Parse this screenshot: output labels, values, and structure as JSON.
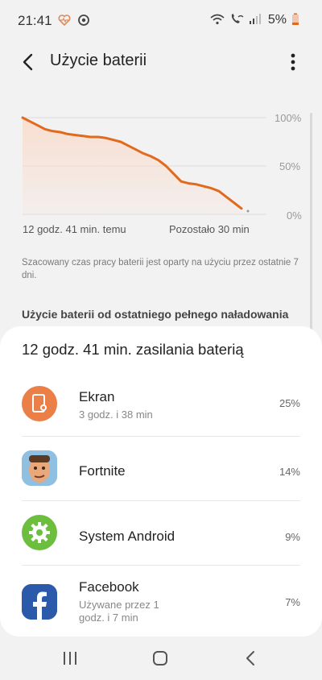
{
  "status_bar": {
    "time": "21:41",
    "battery_percent": "5%",
    "icons": [
      "heart-rate-icon",
      "sync-icon",
      "wifi-icon",
      "wifi-calling-icon",
      "signal-icon",
      "battery-low-icon"
    ]
  },
  "header": {
    "title": "Użycie baterii"
  },
  "chart_data": {
    "type": "area",
    "x_labels": {
      "start": "12 godz. 41 min. temu",
      "end": "Pozostało 30 min"
    },
    "y_ticks": [
      "100%",
      "50%",
      "0%"
    ],
    "ylim": [
      0,
      100
    ],
    "series": [
      {
        "values": [
          100,
          96,
          92,
          88,
          86,
          85,
          83,
          82,
          81,
          80,
          80,
          79,
          77,
          75,
          71,
          67,
          63,
          60,
          56,
          50,
          42,
          34,
          32,
          31,
          29,
          27,
          24,
          18,
          12,
          6
        ]
      }
    ],
    "line_color": "#e06a1e",
    "fill_color": "#f9dccd",
    "grid": true
  },
  "note": "Szacowany czas pracy baterii jest oparty na użyciu przez ostatnie 7 dni.",
  "section_header": "Użycie baterii od ostatniego pełnego naładowania",
  "usage_card": {
    "title": "12 godz. 41 min. zasilania baterią",
    "apps": [
      {
        "name": "Ekran",
        "sub": "3 godz. i 38 min",
        "percent": "25%",
        "icon": "screen-brightness-icon"
      },
      {
        "name": "Fortnite",
        "sub": "",
        "percent": "14%",
        "icon": "fortnite-app-icon"
      },
      {
        "name": "System Android",
        "sub": "",
        "percent": "9%",
        "icon": "android-system-gear-icon"
      },
      {
        "name": "Facebook",
        "sub": "Używane przez 1 godz. i 7 min",
        "percent": "7%",
        "icon": "facebook-icon"
      }
    ]
  },
  "nav_bar": {
    "buttons": [
      "recent-apps-icon",
      "home-icon",
      "back-icon"
    ]
  }
}
